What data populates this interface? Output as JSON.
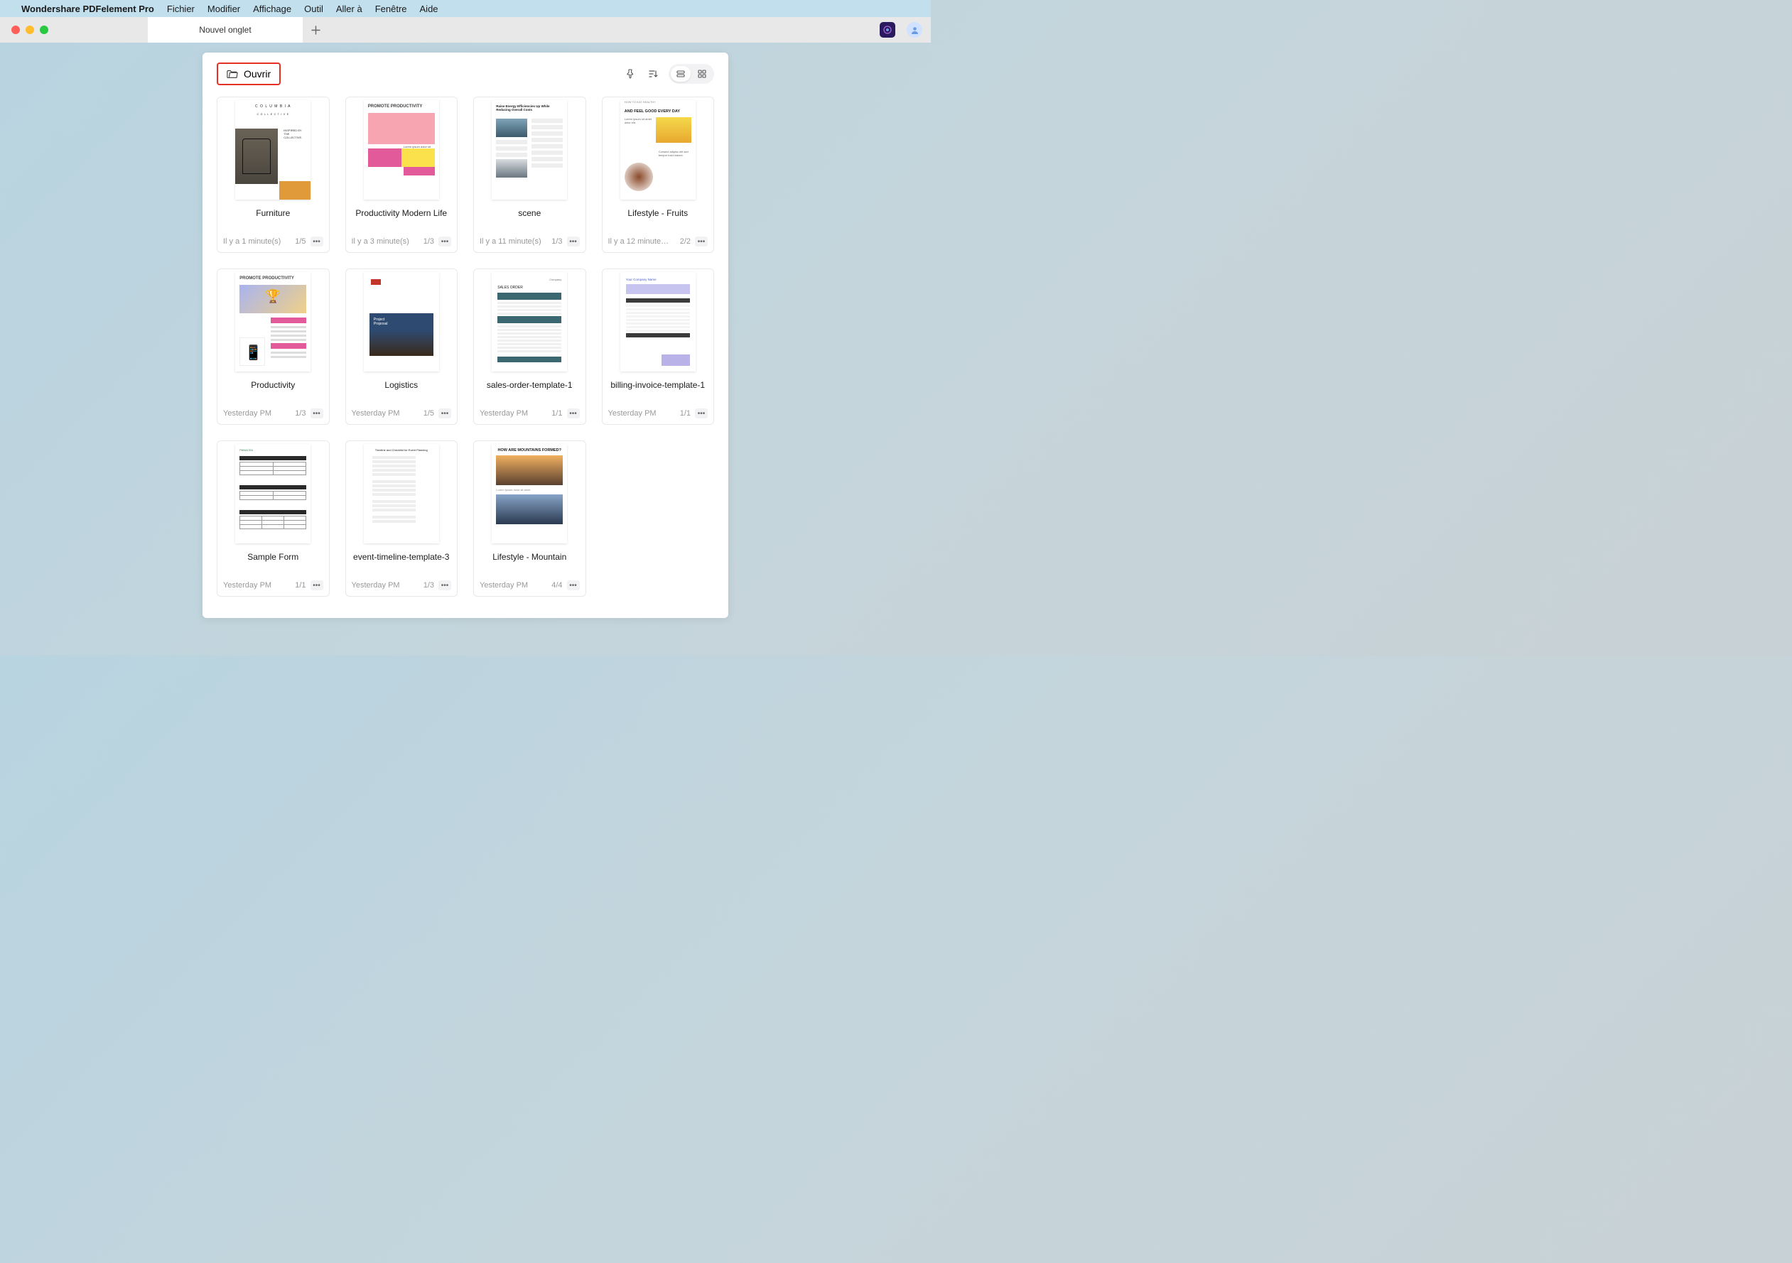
{
  "menubar": {
    "app_name": "Wondershare PDFelement Pro",
    "items": [
      "Fichier",
      "Modifier",
      "Affichage",
      "Outil",
      "Aller à",
      "Fenêtre",
      "Aide"
    ]
  },
  "tabs": {
    "active": "Nouvel onglet"
  },
  "toolbar": {
    "open_label": "Ouvrir"
  },
  "files": [
    {
      "title": "Furniture",
      "time": "Il y a 1 minute(s)",
      "pages": "1/5",
      "thumb": "furniture"
    },
    {
      "title": "Productivity Modern Life",
      "time": "Il y a 3 minute(s)",
      "pages": "1/3",
      "thumb": "prodmod"
    },
    {
      "title": "scene",
      "time": "Il y a 11 minute(s)",
      "pages": "1/3",
      "thumb": "scene"
    },
    {
      "title": "Lifestyle - Fruits",
      "time": "Il y a 12 minute…",
      "pages": "2/2",
      "thumb": "lifestyle"
    },
    {
      "title": "Productivity",
      "time": "Yesterday PM",
      "pages": "1/3",
      "thumb": "prod2"
    },
    {
      "title": "Logistics",
      "time": "Yesterday PM",
      "pages": "1/5",
      "thumb": "log"
    },
    {
      "title": "sales-order-template-1",
      "time": "Yesterday PM",
      "pages": "1/1",
      "thumb": "sales"
    },
    {
      "title": "billing-invoice-template-1",
      "time": "Yesterday PM",
      "pages": "1/1",
      "thumb": "billing"
    },
    {
      "title": "Sample Form",
      "time": "Yesterday PM",
      "pages": "1/1",
      "thumb": "form"
    },
    {
      "title": "event-timeline-template-3",
      "time": "Yesterday PM",
      "pages": "1/3",
      "thumb": "event"
    },
    {
      "title": "Lifestyle - Mountain",
      "time": "Yesterday PM",
      "pages": "4/4",
      "thumb": "mtn"
    }
  ],
  "thumbstrings": {
    "furniture_brand": "C O L U M B I A",
    "furniture_sub": "C O L L E C T I V E",
    "furniture_tag": "INSPIRED BY THE COLLECTIVE.",
    "prodmod_head": "PROMOTE PRODUCTIVITY",
    "scene_head": "Raise Energy Efficiencies Up While Reducing Overall Costs",
    "lifestyle_sm": "HOW TO EAT HEALTHY",
    "lifestyle_hd": "AND FEEL GOOD EVERY DAY",
    "prod2_head": "PROMOTE PRODUCTIVITY",
    "log_label": "Project\nProposal",
    "sales_ttl": "SALES ORDER",
    "billing_co": "Your Company Name",
    "form_co": "PANACEA",
    "event_ttl": "Timeline and Checklist for Event Planning",
    "mtn_hd": "HOW ARE MOUNTAINS FORMED?"
  }
}
